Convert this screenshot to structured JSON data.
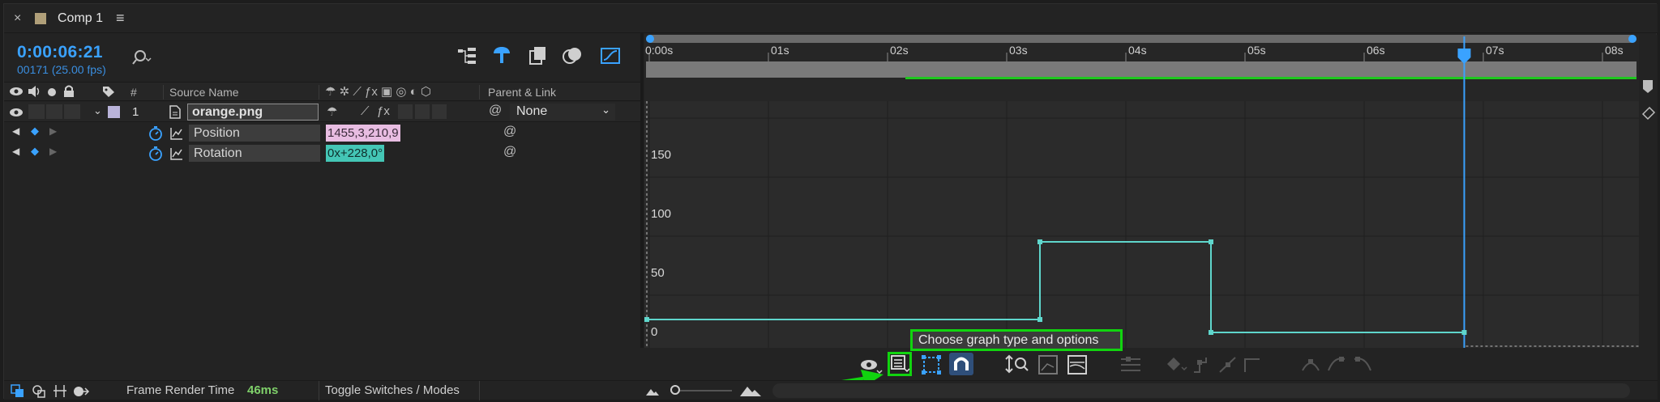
{
  "window": {
    "close_glyph": "×",
    "title": "Comp 1",
    "menu_glyph": "≡"
  },
  "timecode": "0:00:06:21",
  "frame_info": "00171 (25.00 fps)",
  "search": {
    "placeholder": "",
    "icon": "search-icon"
  },
  "columns": {
    "number": "#",
    "source_name": "Source Name",
    "parent_link": "Parent & Link"
  },
  "layer": {
    "number": "1",
    "name": "orange.png",
    "parent": "None",
    "label_color": "#b9b3d9"
  },
  "properties": [
    {
      "name": "Position",
      "value": "1455,3,210,9",
      "value_color": "#e8bde2"
    },
    {
      "name": "Rotation",
      "value": "0x+228,0°",
      "value_color": "#44c6b6"
    }
  ],
  "timeline": {
    "ticks": [
      "0:00s",
      "01s",
      "02s",
      "03s",
      "04s",
      "05s",
      "06s",
      "07s",
      "08s"
    ],
    "playhead_seconds": 6.84
  },
  "graph": {
    "y_labels": [
      "150",
      "100",
      "50",
      "0"
    ],
    "curve_color": "#5fd6cc"
  },
  "tooltip": "Choose graph type and options",
  "status": {
    "frame_render_label": "Frame Render Time",
    "frame_render_value": "46ms",
    "toggle_label": "Toggle Switches / Modes"
  },
  "accent_color": "#3aa2ff",
  "highlight_color": "#11d40f"
}
